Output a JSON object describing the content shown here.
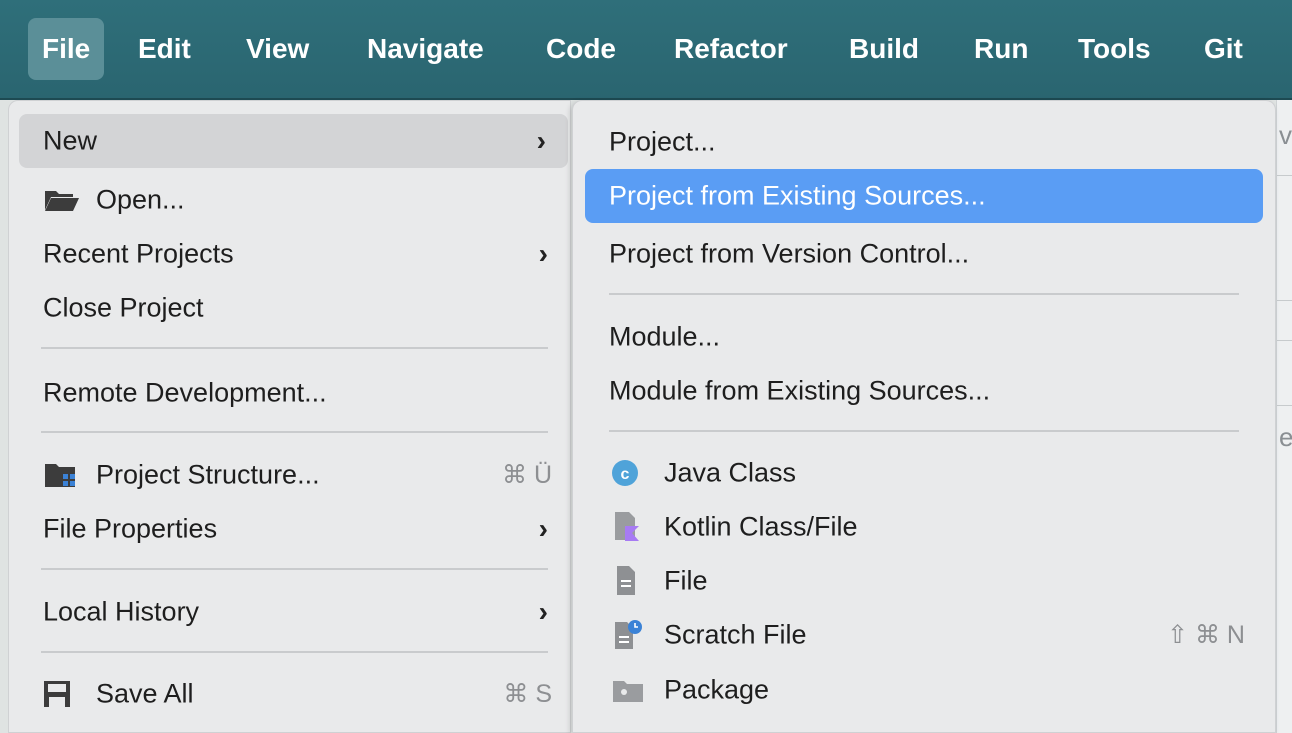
{
  "menubar": {
    "items": [
      "File",
      "Edit",
      "View",
      "Navigate",
      "Code",
      "Refactor",
      "Build",
      "Run",
      "Tools",
      "Git"
    ],
    "active": "File"
  },
  "file_menu": {
    "new_label": "New",
    "open_label": "Open...",
    "recent_projects_label": "Recent Projects",
    "close_project_label": "Close Project",
    "remote_development_label": "Remote Development...",
    "project_structure_label": "Project Structure...",
    "project_structure_shortcut": "⌘ Ü",
    "file_properties_label": "File Properties",
    "local_history_label": "Local History",
    "save_all_label": "Save All",
    "save_all_shortcut": "⌘ S",
    "submenu_arrow": "›"
  },
  "new_submenu": {
    "project_label": "Project...",
    "project_from_existing_label": "Project from Existing Sources...",
    "project_from_vcs_label": "Project from Version Control...",
    "module_label": "Module...",
    "module_from_existing_label": "Module from Existing Sources...",
    "java_class_label": "Java Class",
    "kotlin_class_label": "Kotlin Class/File",
    "file_label": "File",
    "scratch_file_label": "Scratch File",
    "scratch_file_shortcut": "⇧ ⌘ N",
    "package_label": "Package"
  },
  "background_edge": {
    "letter_top": "v",
    "letter_mid": "e"
  },
  "colors": {
    "menubar": "#2f6f7a",
    "selected": "#5a9df4",
    "java_icon": "#4fa3d9",
    "kotlin_icon": "#a77bf3"
  }
}
